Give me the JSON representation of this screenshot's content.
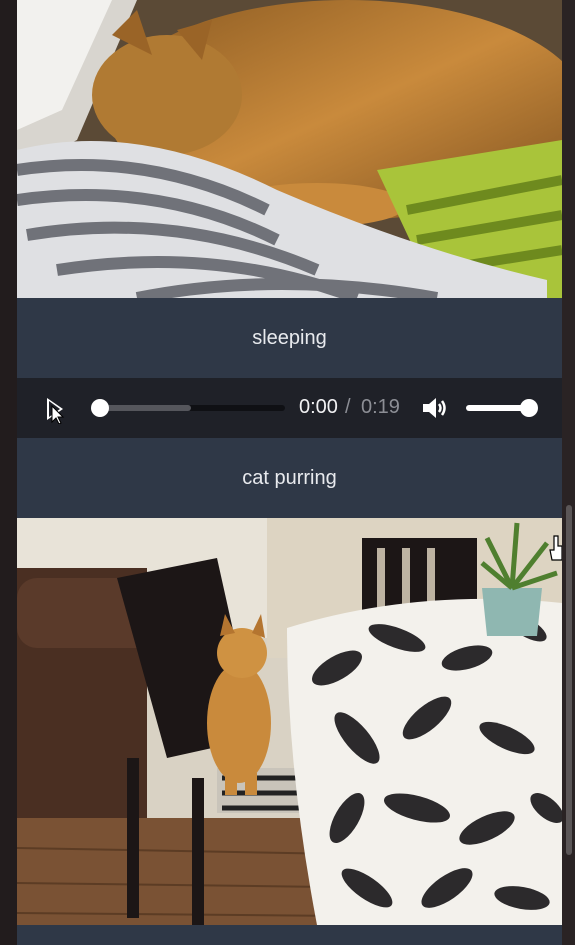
{
  "items": [
    {
      "caption": "sleeping"
    },
    {
      "caption": "cat purring"
    }
  ],
  "audio": {
    "current_time": "0:00",
    "separator": "/",
    "duration": "0:19",
    "progress": 0,
    "buffered": 0.5,
    "volume": 1.0
  },
  "icons": {
    "play": "play-icon",
    "volume": "volume-icon",
    "pointer_cursor": "hand-cursor-icon"
  },
  "colors": {
    "panel": "#2f3847",
    "player": "#1f2128",
    "page_background": "#221c1d",
    "text": "#e8eaee"
  }
}
